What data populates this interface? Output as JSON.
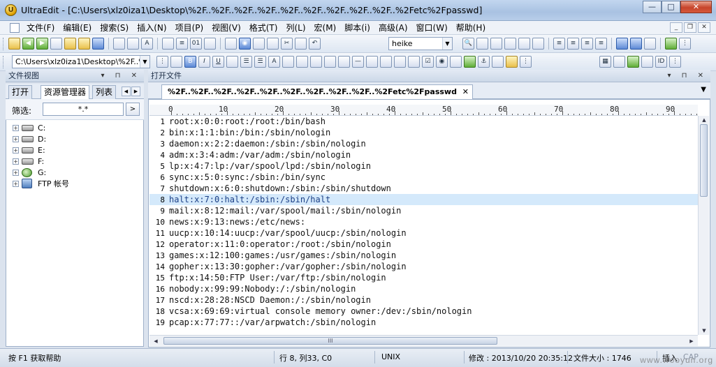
{
  "window": {
    "app_name": "UltraEdit",
    "title": "UltraEdit - [C:\\Users\\xlz0iza1\\Desktop\\%2F..%2F..%2F..%2F..%2F..%2F..%2F..%2F..%2F..%2Fetc%2Fpasswd]",
    "btn_minimize": "—",
    "btn_maximize": "□",
    "btn_close": "✕"
  },
  "menu": {
    "items": [
      "文件(F)",
      "编辑(E)",
      "搜索(S)",
      "插入(N)",
      "项目(P)",
      "视图(V)",
      "格式(T)",
      "列(L)",
      "宏(M)",
      "脚本(i)",
      "高级(A)",
      "窗口(W)",
      "帮助(H)"
    ],
    "mdi_min": "_",
    "mdi_restore": "❐",
    "mdi_close": "✕"
  },
  "toolbar": {
    "font_combo_value": "heike",
    "path_combo_value": "C:\\Users\\xlz0iza1\\Desktop\\%2F..%2",
    "dropdown_arrow": "▼"
  },
  "left_pane": {
    "header": "文件视图",
    "header_buttons": "▾ ⊓ ✕",
    "tabs": [
      "打开",
      "资源管理器",
      "列表"
    ],
    "active_tab": "资源管理器",
    "tab_scroll_left": "◀",
    "tab_scroll_right": "▶",
    "filter_label": "筛选:",
    "filter_value": "*.*",
    "filter_go": ">",
    "tree": [
      {
        "label": "C:",
        "type": "drive"
      },
      {
        "label": "D:",
        "type": "drive"
      },
      {
        "label": "E:",
        "type": "drive"
      },
      {
        "label": "F:",
        "type": "drive"
      },
      {
        "label": "G:",
        "type": "network"
      },
      {
        "label": "FTP 帐号",
        "type": "ftp"
      }
    ],
    "expand_glyph": "+"
  },
  "editor": {
    "header": "打开文件",
    "header_buttons": "▾ ⊓ ✕",
    "tab_title": "%2F..%2F..%2F..%2F..%2F..%2F..%2F..%2F..%2F..%2Fetc%2Fpasswd",
    "tab_close": "✕",
    "tab_menu": "▼",
    "ruler_labels": [
      "0",
      "10",
      "20",
      "30",
      "40",
      "50",
      "60",
      "70",
      "80",
      "90"
    ],
    "highlighted_line": 8,
    "lines": [
      "root:x:0:0:root:/root:/bin/bash",
      "bin:x:1:1:bin:/bin:/sbin/nologin",
      "daemon:x:2:2:daemon:/sbin:/sbin/nologin",
      "adm:x:3:4:adm:/var/adm:/sbin/nologin",
      "lp:x:4:7:lp:/var/spool/lpd:/sbin/nologin",
      "sync:x:5:0:sync:/sbin:/bin/sync",
      "shutdown:x:6:0:shutdown:/sbin:/sbin/shutdown",
      "halt:x:7:0:halt:/sbin:/sbin/halt",
      "mail:x:8:12:mail:/var/spool/mail:/sbin/nologin",
      "news:x:9:13:news:/etc/news:",
      "uucp:x:10:14:uucp:/var/spool/uucp:/sbin/nologin",
      "operator:x:11:0:operator:/root:/sbin/nologin",
      "games:x:12:100:games:/usr/games:/sbin/nologin",
      "gopher:x:13:30:gopher:/var/gopher:/sbin/nologin",
      "ftp:x:14:50:FTP User:/var/ftp:/sbin/nologin",
      "nobody:x:99:99:Nobody:/:/sbin/nologin",
      "nscd:x:28:28:NSCD Daemon:/:/sbin/nologin",
      "vcsa:x:69:69:virtual console memory owner:/dev:/sbin/nologin",
      "pcap:x:77:77::/var/arpwatch:/sbin/nologin"
    ],
    "hscroll_grip": "III"
  },
  "status": {
    "help": "按 F1 获取帮助",
    "position": "行 8, 列33, C0",
    "line_ending": "UNIX",
    "modified": "修改 : 2013/10/20 20:35:12",
    "file_size": "文件大小 : 1746",
    "insert_mode": "插入",
    "cap": "CAP"
  },
  "watermark": "www.wooyun.org"
}
